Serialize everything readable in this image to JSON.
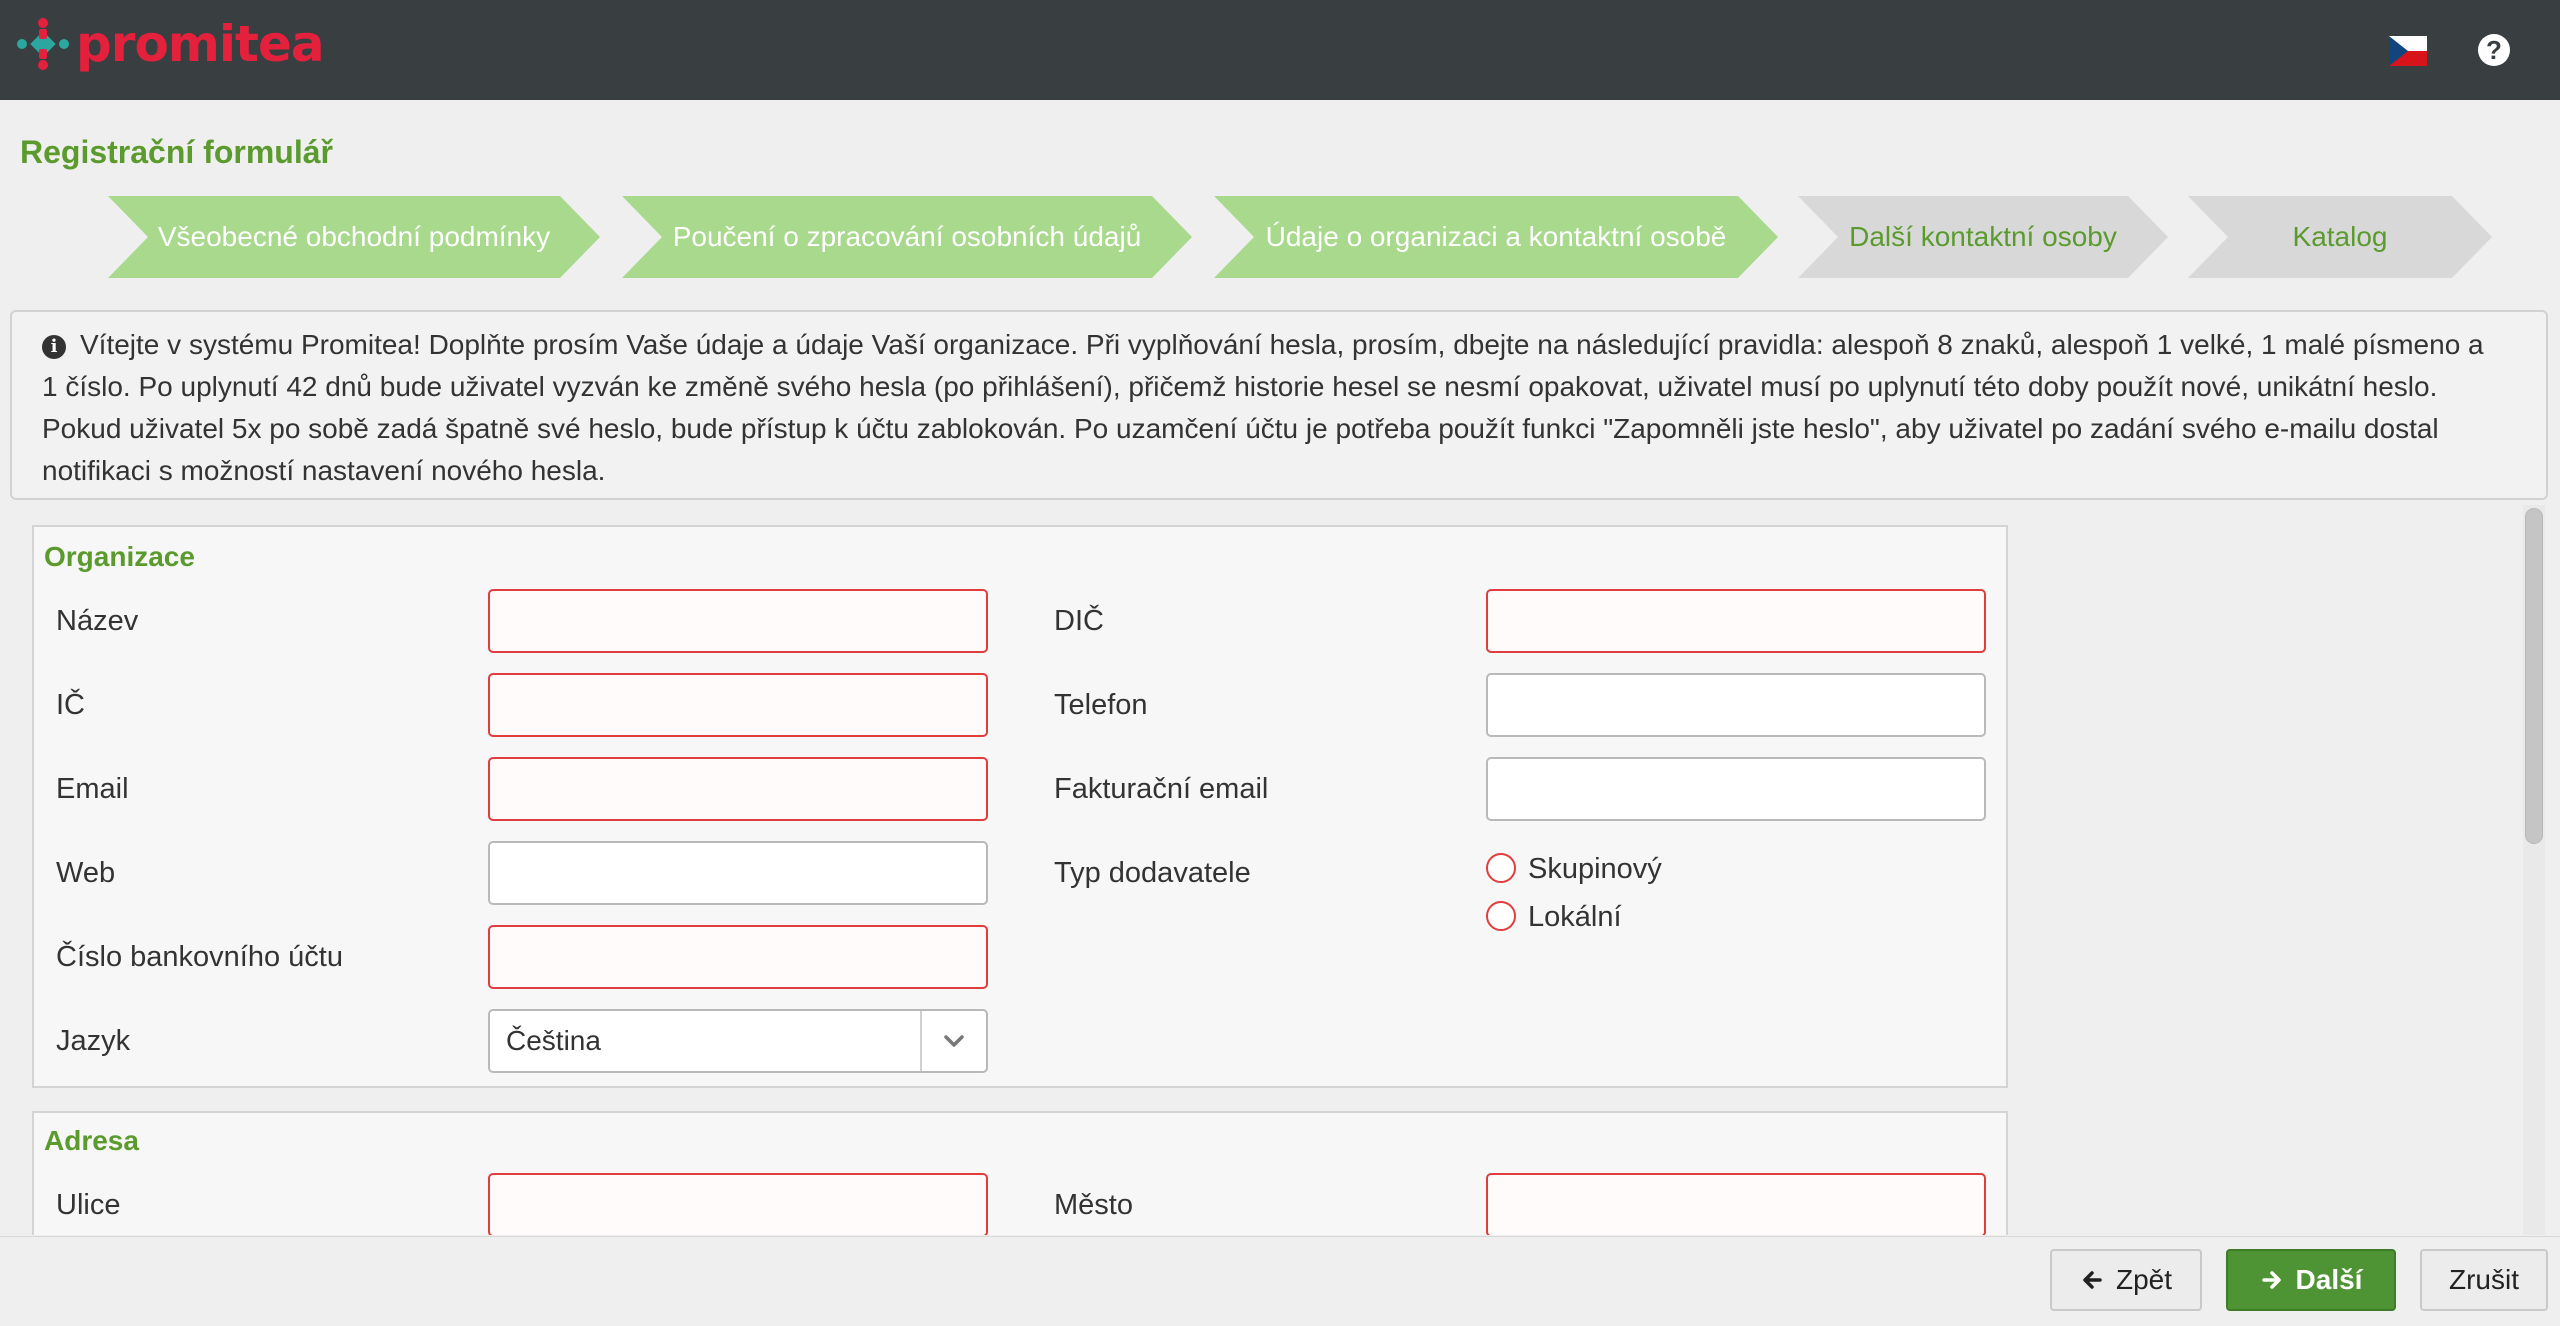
{
  "header": {
    "brand": "promitea",
    "language_flag": "czech-flag-icon",
    "help_icon": "?"
  },
  "page": {
    "title": "Registrační formulář"
  },
  "wizard": {
    "steps": [
      {
        "label": "Všeobecné obchodní podmínky",
        "state": "done"
      },
      {
        "label": "Poučení o zpracování osobních údajů",
        "state": "done"
      },
      {
        "label": "Údaje o organizaci a kontaktní osobě",
        "state": "current"
      },
      {
        "label": "Další kontaktní osoby",
        "state": "todo"
      },
      {
        "label": "Katalog",
        "state": "todo"
      }
    ]
  },
  "info": {
    "text": "Vítejte v systému Promitea! Doplňte prosím Vaše údaje a údaje Vaší organizace. Při vyplňování hesla, prosím, dbejte na následující pravidla: alespoň 8 znaků, alespoň 1 velké, 1 malé písmeno a 1 číslo. Po uplynutí 42 dnů bude uživatel vyzván ke změně svého hesla (po přihlášení), přičemž historie hesel se nesmí opakovat, uživatel musí po uplynutí této doby použít nové, unikátní heslo. Pokud uživatel 5x po sobě zadá špatně své heslo, bude přístup k účtu zablokován. Po uzamčení účtu je potřeba použít funkci \"Zapomněli jste heslo\", aby uživatel po zadání svého e-mailu dostal notifikaci s možností nastavení nového hesla."
  },
  "organizace": {
    "title": "Organizace",
    "nazev": {
      "label": "Název",
      "value": ""
    },
    "ic": {
      "label": "IČ",
      "value": ""
    },
    "email": {
      "label": "Email",
      "value": ""
    },
    "web": {
      "label": "Web",
      "value": ""
    },
    "ucet": {
      "label": "Číslo bankovního účtu",
      "value": ""
    },
    "jazyk": {
      "label": "Jazyk",
      "value": "Čeština"
    },
    "dic": {
      "label": "DIČ",
      "value": ""
    },
    "telefon": {
      "label": "Telefon",
      "value": ""
    },
    "fakturacni_email": {
      "label": "Fakturační email",
      "value": ""
    },
    "typ_dodavatele": {
      "label": "Typ dodavatele",
      "options": [
        "Skupinový",
        "Lokální"
      ]
    }
  },
  "adresa": {
    "title": "Adresa",
    "ulice": {
      "label": "Ulice",
      "value": ""
    },
    "mesto": {
      "label": "Město",
      "value": ""
    }
  },
  "footer": {
    "back_label": "Zpět",
    "next_label": "Další",
    "cancel_label": "Zrušit"
  },
  "colors": {
    "brand": "#e4213d",
    "accent_green": "#5b9b2e",
    "required_border": "#e23d3d",
    "topbar": "#393e40"
  }
}
